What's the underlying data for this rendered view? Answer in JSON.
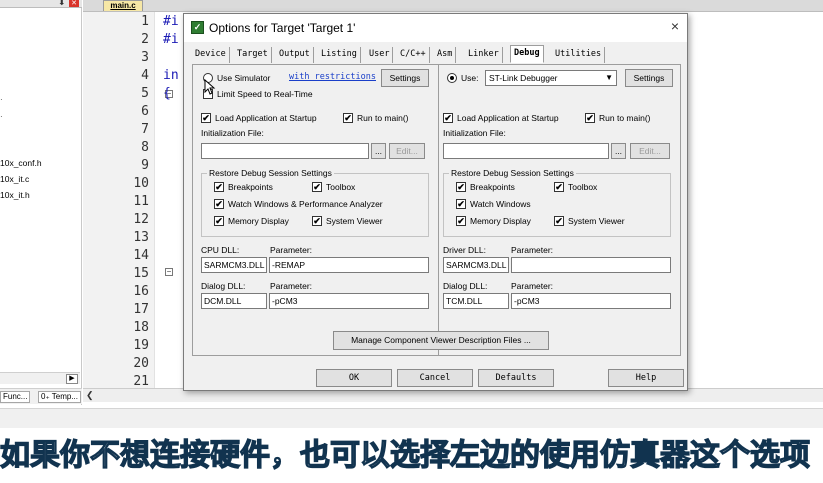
{
  "left_panel": {
    "pin_icon": "pin-icon",
    "close_icon": "close-icon",
    "files": [
      "10x_conf.h",
      "10x_it.c",
      "10x_it.h"
    ],
    "tabs": [
      "Func...",
      "0₊ Temp..."
    ]
  },
  "editor": {
    "tab_label": "main.c",
    "line_numbers": [
      "1",
      "2",
      "3",
      "4",
      "5",
      "6",
      "7",
      "8",
      "9",
      "10",
      "11",
      "12",
      "13",
      "14",
      "15",
      "16",
      "17",
      "18",
      "19",
      "20",
      "21"
    ],
    "code": {
      "line1": "#i",
      "line2": "#i",
      "line4": "in",
      "line5": "{"
    }
  },
  "dialog": {
    "title": "Options for Target 'Target 1'",
    "tabs": [
      "Device",
      "Target",
      "Output",
      "Listing",
      "User",
      "C/C++",
      "Asm",
      "Linker",
      "Debug",
      "Utilities"
    ],
    "active_tab": "Debug",
    "left": {
      "use_simulator": "Use Simulator",
      "restrictions_link": "with restrictions",
      "settings": "Settings",
      "limit_speed": "Limit Speed to Real-Time",
      "load_app": "Load Application at Startup",
      "run_to_main": "Run to main()",
      "init_file_label": "Initialization File:",
      "browse": "...",
      "edit": "Edit...",
      "restore_group": "Restore Debug Session Settings",
      "breakpoints": "Breakpoints",
      "toolbox": "Toolbox",
      "watch_windows": "Watch Windows & Performance Analyzer",
      "memory_display": "Memory Display",
      "system_viewer": "System Viewer",
      "cpu_dll_label": "CPU DLL:",
      "param_label": "Parameter:",
      "cpu_dll": "SARMCM3.DLL",
      "cpu_param": "-REMAP",
      "dialog_dll_label": "Dialog DLL:",
      "dialog_dll": "DCM.DLL",
      "dialog_param": "-pCM3"
    },
    "right": {
      "use": "Use:",
      "debugger": "ST-Link Debugger",
      "settings": "Settings",
      "load_app": "Load Application at Startup",
      "run_to_main": "Run to main()",
      "init_file_label": "Initialization File:",
      "browse": "...",
      "edit": "Edit...",
      "restore_group": "Restore Debug Session Settings",
      "breakpoints": "Breakpoints",
      "toolbox": "Toolbox",
      "watch_windows": "Watch Windows",
      "memory_display": "Memory Display",
      "system_viewer": "System Viewer",
      "driver_dll_label": "Driver DLL:",
      "param_label": "Parameter:",
      "driver_dll": "SARMCM3.DLL",
      "driver_param": "",
      "dialog_dll_label": "Dialog DLL:",
      "dialog_dll": "TCM.DLL",
      "dialog_param": "-pCM3"
    },
    "manage_button": "Manage Component Viewer Description Files ...",
    "buttons": {
      "ok": "OK",
      "cancel": "Cancel",
      "defaults": "Defaults",
      "help": "Help"
    },
    "check_mark": "✔",
    "close_glyph": "×"
  },
  "subtitle": "如果你不想连接硬件，也可以选择左边的使用仿真器这个选项"
}
